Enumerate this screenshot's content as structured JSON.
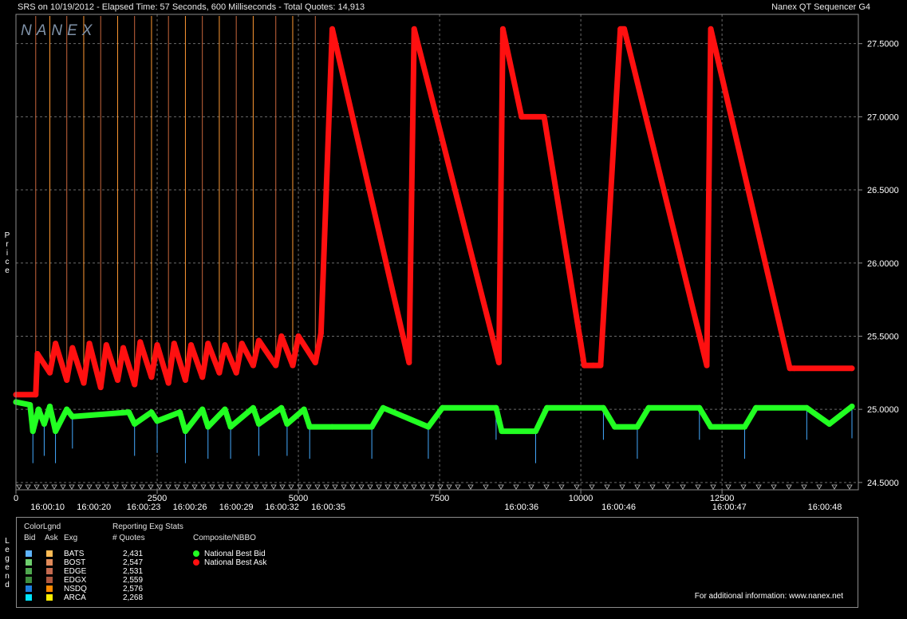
{
  "header": {
    "left": "SRS on 10/19/2012  -  Elapsed Time: 57 Seconds, 600 Milliseconds  -  Total Quotes: 14,913",
    "right": "Nanex QT Sequencer G4",
    "logo": "NANEX"
  },
  "y_axis_label": "Price",
  "legend_side_label": "Legend",
  "colors": {
    "background": "#000000",
    "plot_border": "#8c8c8c",
    "grid": "#6a6a6a",
    "bid_nbbo": "#22ff22",
    "ask_nbbo": "#ff1010",
    "ask_exchange_line": "#ff9933",
    "bid_exchange_line": "#44aaff"
  },
  "chart_data": {
    "type": "line",
    "title": "",
    "xlabel": "",
    "ylabel": "Price",
    "xlim": [
      0,
      14913
    ],
    "ylim": [
      24.45,
      27.7
    ],
    "grid": true,
    "y_ticks": [
      "24.5000",
      "25.0000",
      "25.5000",
      "26.0000",
      "26.5000",
      "27.0000",
      "27.5000"
    ],
    "y_tick_values": [
      24.5,
      25.0,
      25.5,
      26.0,
      26.5,
      27.0,
      27.5
    ],
    "x_ticks": [
      "0",
      "2500",
      "5000",
      "7500",
      "10000",
      "12500"
    ],
    "x_tick_values": [
      0,
      2500,
      5000,
      7500,
      10000,
      12500
    ],
    "time_labels": [
      "16:00:10",
      "16:00:20",
      "16:00:23",
      "16:00:26",
      "16:00:29",
      "16:00:32",
      "16:00:35",
      "16:00:36",
      "16:00:46",
      "16:00:47",
      "16:00:48"
    ],
    "time_label_quotes": [
      560,
      1380,
      2260,
      3080,
      3900,
      4710,
      5530,
      8950,
      10670,
      12630,
      14320
    ],
    "series": [
      {
        "name": "National Best Ask",
        "x": [
          0,
          350,
          380,
          600,
          700,
          900,
          1000,
          1200,
          1300,
          1500,
          1600,
          1800,
          1900,
          2100,
          2200,
          2400,
          2500,
          2700,
          2800,
          3000,
          3100,
          3300,
          3400,
          3600,
          3700,
          3900,
          4000,
          4200,
          4300,
          4600,
          4700,
          4900,
          5000,
          5300,
          5400,
          5600,
          6960,
          7050,
          8550,
          8620,
          8950,
          9350,
          10000,
          10060,
          10220,
          10350,
          10700,
          10770,
          12230,
          12300,
          13700,
          13780,
          14800
        ],
        "y": [
          25.1,
          25.1,
          25.38,
          25.25,
          25.45,
          25.2,
          25.42,
          25.18,
          25.45,
          25.15,
          25.44,
          25.2,
          25.42,
          25.17,
          25.46,
          25.22,
          25.44,
          25.18,
          25.45,
          25.2,
          25.44,
          25.22,
          25.45,
          25.25,
          25.44,
          25.25,
          25.45,
          25.3,
          25.47,
          25.3,
          25.5,
          25.3,
          25.5,
          25.32,
          25.52,
          27.6,
          25.32,
          27.6,
          25.32,
          27.6,
          27.0,
          27.0,
          25.45,
          25.3,
          25.3,
          25.3,
          27.6,
          27.6,
          25.3,
          27.6,
          25.28,
          25.28,
          25.28
        ]
      },
      {
        "name": "National Best Bid",
        "x": [
          0,
          250,
          300,
          400,
          500,
          600,
          700,
          900,
          1000,
          2000,
          2100,
          2400,
          2500,
          2900,
          3000,
          3300,
          3400,
          3700,
          3800,
          4200,
          4300,
          4700,
          4800,
          5100,
          5200,
          5600,
          6300,
          6500,
          7300,
          7550,
          8500,
          8600,
          9200,
          9400,
          10400,
          10600,
          11000,
          11200,
          12100,
          12300,
          12900,
          13100,
          14000,
          14400,
          14800
        ],
        "y": [
          25.05,
          25.03,
          24.85,
          25.0,
          24.9,
          25.02,
          24.85,
          25.0,
          24.95,
          24.98,
          24.9,
          24.98,
          24.92,
          24.98,
          24.85,
          25.0,
          24.88,
          25.0,
          24.88,
          25.01,
          24.9,
          25.01,
          24.9,
          25.0,
          24.88,
          24.88,
          24.88,
          25.01,
          24.88,
          25.01,
          25.01,
          24.85,
          24.85,
          25.01,
          25.01,
          24.88,
          24.88,
          25.01,
          25.01,
          24.88,
          24.88,
          25.01,
          25.01,
          24.9,
          25.02
        ]
      }
    ],
    "annotations": [
      "For additional information: www.nanex.net"
    ]
  },
  "legend": {
    "color_legend_title": "ColorLgnd",
    "stats_title": "Reporting Exg Stats",
    "col_bid": "Bid",
    "col_ask": "Ask",
    "col_exg": "Exg",
    "col_quotes": "# Quotes",
    "composite_title": "Composite/NBBO",
    "rows": [
      {
        "exg": "BATS",
        "quotes": "2,431",
        "bid_color": "#5fb4ff",
        "ask_color": "#ffbb55"
      },
      {
        "exg": "BOST",
        "quotes": "2,547",
        "bid_color": "#6fcf6f",
        "ask_color": "#e08a5a"
      },
      {
        "exg": "EDGE",
        "quotes": "2,531",
        "bid_color": "#4fa84f",
        "ask_color": "#c46a50"
      },
      {
        "exg": "EDGX",
        "quotes": "2,559",
        "bid_color": "#3f8f3f",
        "ask_color": "#b05840"
      },
      {
        "exg": "NSDQ",
        "quotes": "2,576",
        "bid_color": "#1e7fe0",
        "ask_color": "#ff8a00"
      },
      {
        "exg": "ARCA",
        "quotes": "2,268",
        "bid_color": "#00e5ff",
        "ask_color": "#ffee00"
      }
    ],
    "nbbo": [
      {
        "label": "National Best Bid",
        "color": "#22ff22"
      },
      {
        "label": "National Best Ask",
        "color": "#ff1010"
      }
    ],
    "footer": "For additional information: www.nanex.net"
  }
}
